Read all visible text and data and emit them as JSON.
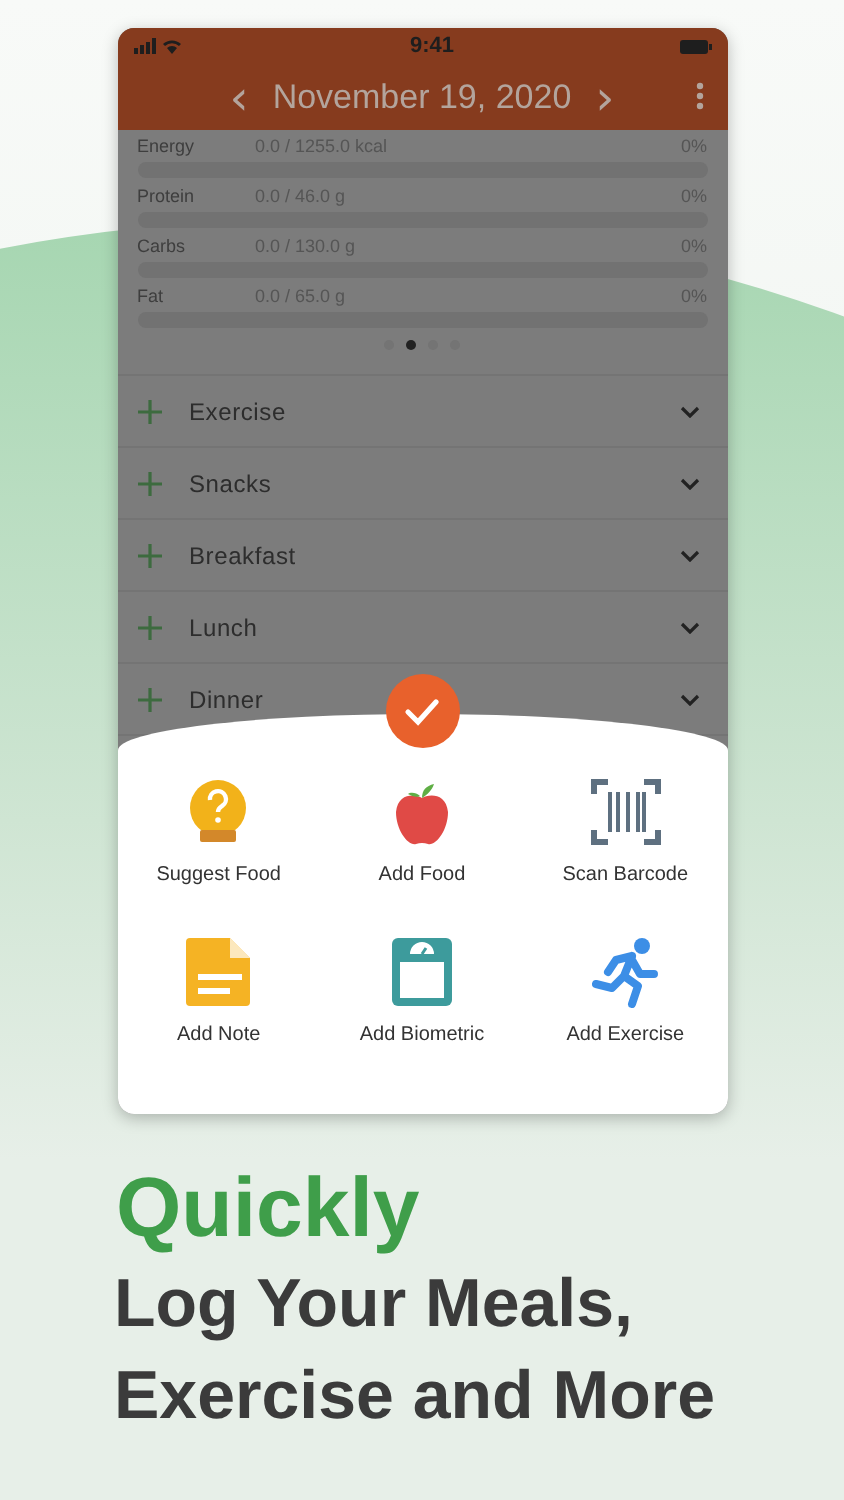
{
  "status_bar": {
    "time": "9:41"
  },
  "header": {
    "prev": "‹",
    "date": "November 19, 2020",
    "next": "›"
  },
  "macros": [
    {
      "name": "Energy",
      "value": "0.0 / 1255.0 kcal",
      "percent": "0%",
      "level": 0
    },
    {
      "name": "Protein",
      "value": "0.0 / 46.0 g",
      "percent": "0%",
      "level": 0
    },
    {
      "name": "Carbs",
      "value": "0.0 / 130.0 g",
      "percent": "0%",
      "level": 0
    },
    {
      "name": "Fat",
      "value": "0.0 / 65.0 g",
      "percent": "0%",
      "level": 0
    }
  ],
  "page_dots": [
    {
      "selected": false
    },
    {
      "selected": true
    },
    {
      "selected": false
    },
    {
      "selected": false
    }
  ],
  "meals": [
    {
      "label": "Exercise"
    },
    {
      "label": "Snacks"
    },
    {
      "label": "Breakfast"
    },
    {
      "label": "Lunch"
    },
    {
      "label": "Dinner"
    }
  ],
  "actions": [
    {
      "kind": "suggest",
      "label": "Suggest Food"
    },
    {
      "kind": "food",
      "label": "Add Food"
    },
    {
      "kind": "barcode",
      "label": "Scan Barcode"
    },
    {
      "kind": "note",
      "label": "Add Note"
    },
    {
      "kind": "biometric",
      "label": "Add Biometric"
    },
    {
      "kind": "exercise",
      "label": "Add Exercise"
    }
  ],
  "headline": {
    "accent": "Quickly",
    "lines": [
      "Log Your Meals,",
      "Exercise and More"
    ]
  }
}
